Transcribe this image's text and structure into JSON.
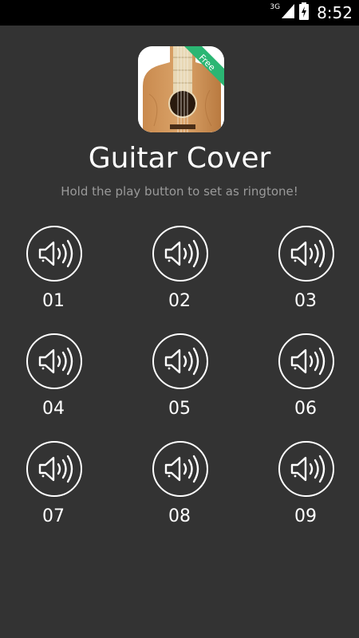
{
  "status_bar": {
    "network": "3G",
    "time": "8:52",
    "icons": [
      "signal-icon",
      "battery-charging-icon"
    ]
  },
  "app": {
    "icon": "guitar-app-icon",
    "badge": "Free",
    "badge_color": "#2bb673",
    "title": "Guitar Cover",
    "subtitle": "Hold the play button to set as ringtone!"
  },
  "sounds": [
    {
      "label": "01",
      "icon": "speaker-icon"
    },
    {
      "label": "02",
      "icon": "speaker-icon"
    },
    {
      "label": "03",
      "icon": "speaker-icon"
    },
    {
      "label": "04",
      "icon": "speaker-icon"
    },
    {
      "label": "05",
      "icon": "speaker-icon"
    },
    {
      "label": "06",
      "icon": "speaker-icon"
    },
    {
      "label": "07",
      "icon": "speaker-icon"
    },
    {
      "label": "08",
      "icon": "speaker-icon"
    },
    {
      "label": "09",
      "icon": "speaker-icon"
    }
  ],
  "colors": {
    "background": "#333333",
    "status_bar": "#000000",
    "text": "#ffffff",
    "subtitle": "#9a9a9a"
  }
}
